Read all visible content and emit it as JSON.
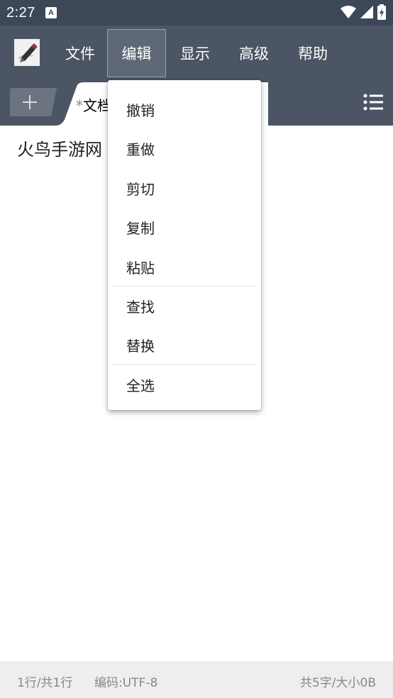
{
  "status_bar": {
    "time": "2:27",
    "notification_icon": "A",
    "icons": [
      "wifi-icon",
      "signal-icon",
      "battery-icon"
    ]
  },
  "menubar": {
    "app_icon": "notepad-icon",
    "items": [
      {
        "label": "文件"
      },
      {
        "label": "编辑"
      },
      {
        "label": "显示"
      },
      {
        "label": "高级"
      },
      {
        "label": "帮助"
      }
    ],
    "active_index": 1
  },
  "tabbar": {
    "add_icon": "plus-icon",
    "tab_modified_marker": "*",
    "tab_title": "文档",
    "list_icon": "list-icon"
  },
  "editor": {
    "text": "火鸟手游网"
  },
  "dropdown": {
    "items": [
      {
        "label": "撤销"
      },
      {
        "label": "重做"
      },
      {
        "label": "剪切"
      },
      {
        "label": "复制"
      },
      {
        "label": "粘贴"
      },
      {
        "label": "查找"
      },
      {
        "label": "替换"
      },
      {
        "label": "全选"
      }
    ]
  },
  "footer": {
    "line_info": "1行/共1行",
    "encoding": "编码:UTF-8",
    "size_info": "共5字/大小0B"
  },
  "colors": {
    "status_bar": "#3c4858",
    "toolbar": "#4b5563",
    "active_menu": "#5e6876",
    "footer_bg": "#eeeeee",
    "footer_text": "#888888"
  }
}
